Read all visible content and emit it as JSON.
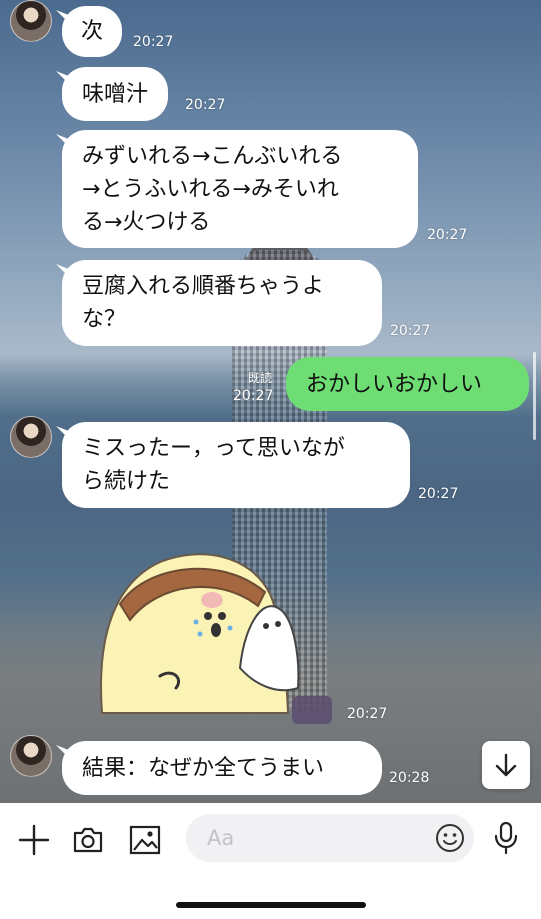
{
  "messages": [
    {
      "text": "次",
      "time": "20:27"
    },
    {
      "text": "味噌汁",
      "time": "20:27"
    },
    {
      "lines": [
        "みずいれる→こんぶいれる",
        "→とうふいれる→みそいれ",
        "る→火つける"
      ],
      "time": "20:27"
    },
    {
      "lines": [
        "豆腐入れる順番ちゃうよ",
        "な？"
      ],
      "time": "20:27"
    },
    {
      "text": "おかしいおかしい",
      "time": "20:27",
      "read": "既読"
    },
    {
      "lines": [
        "ミスったー，って思いなが",
        "ら続けた"
      ],
      "time": "20:27"
    },
    {
      "time": "20:27"
    },
    {
      "text": "結果：なぜか全てうまい",
      "time": "20:28"
    }
  ],
  "input": {
    "placeholder": "Aa"
  },
  "colors": {
    "my_bubble": "#6ddd74",
    "their_bubble": "#ffffff"
  }
}
